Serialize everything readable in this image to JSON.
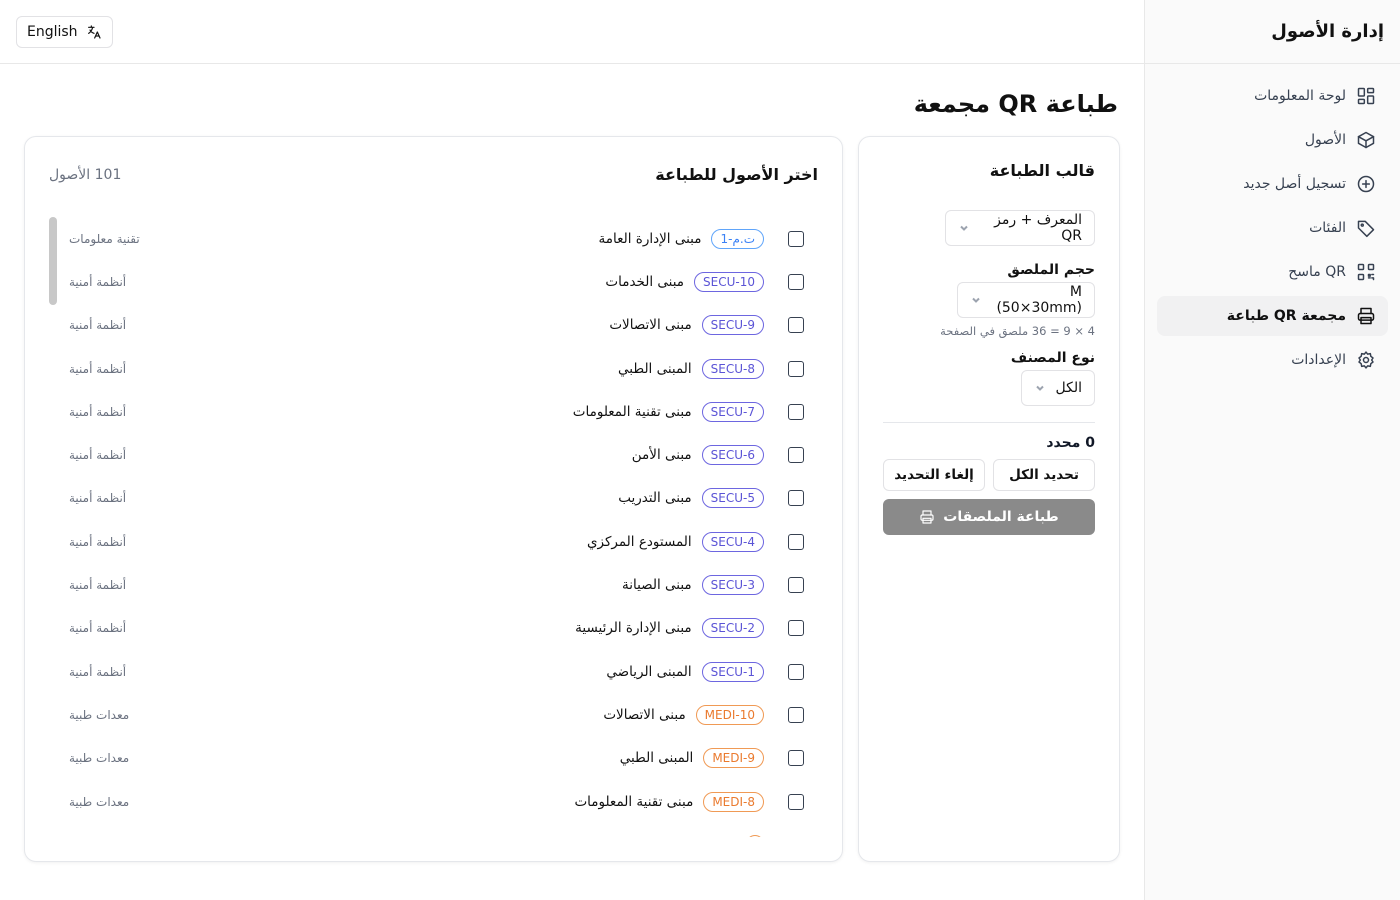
{
  "app": {
    "title": "إدارة الأصول"
  },
  "topbar": {
    "language_label": "English"
  },
  "sidebar": {
    "items": [
      {
        "label": "لوحة المعلومات",
        "icon": "dashboard-icon"
      },
      {
        "label": "الأصول",
        "icon": "box-icon"
      },
      {
        "label": "تسجيل أصل جديد",
        "icon": "plus-circle-icon"
      },
      {
        "label": "الفئات",
        "icon": "tag-icon"
      },
      {
        "label": "ماسح QR",
        "icon": "qr-icon"
      },
      {
        "label": "طباعة QR مجمعة",
        "icon": "printer-icon",
        "active": true
      },
      {
        "label": "الإعدادات",
        "icon": "gear-icon"
      }
    ]
  },
  "page": {
    "title": "طباعة QR مجمعة"
  },
  "template": {
    "title": "قالب الطباعة",
    "template_select": "المعرف + رمز QR",
    "size_label": "حجم الملصق",
    "size_select": "M (50×30mm)",
    "size_hint": "4 × 9 = 36 ملصق في الصفحة",
    "category_label": "نوع المصنف",
    "category_select": "الكل",
    "selected_count": "0 محدد",
    "select_all": "تحديد الكل",
    "deselect": "إلغاء التحديد",
    "print": "طباعة الملصقات"
  },
  "assets": {
    "title": "اختر الأصول للطباعة",
    "count": "101 الأصول",
    "rows": [
      {
        "code": "ت.م-1",
        "name": "مبنى الإدارة العامة",
        "category": "تقنية معلومات",
        "color": "blue"
      },
      {
        "code": "SECU-10",
        "name": "مبنى الخدمات",
        "category": "أنظمة أمنية",
        "color": "indigo"
      },
      {
        "code": "SECU-9",
        "name": "مبنى الاتصالات",
        "category": "أنظمة أمنية",
        "color": "indigo"
      },
      {
        "code": "SECU-8",
        "name": "المبنى الطبي",
        "category": "أنظمة أمنية",
        "color": "indigo"
      },
      {
        "code": "SECU-7",
        "name": "مبنى تقنية المعلومات",
        "category": "أنظمة أمنية",
        "color": "indigo"
      },
      {
        "code": "SECU-6",
        "name": "مبنى الأمن",
        "category": "أنظمة أمنية",
        "color": "indigo"
      },
      {
        "code": "SECU-5",
        "name": "مبنى التدريب",
        "category": "أنظمة أمنية",
        "color": "indigo"
      },
      {
        "code": "SECU-4",
        "name": "المستودع المركزي",
        "category": "أنظمة أمنية",
        "color": "indigo"
      },
      {
        "code": "SECU-3",
        "name": "مبنى الصيانة",
        "category": "أنظمة أمنية",
        "color": "indigo"
      },
      {
        "code": "SECU-2",
        "name": "مبنى الإدارة الرئيسية",
        "category": "أنظمة أمنية",
        "color": "indigo"
      },
      {
        "code": "SECU-1",
        "name": "المبنى الرياضي",
        "category": "أنظمة أمنية",
        "color": "indigo"
      },
      {
        "code": "MEDI-10",
        "name": "مبنى الاتصالات",
        "category": "معدات طبية",
        "color": "orange"
      },
      {
        "code": "MEDI-9",
        "name": "المبنى الطبي",
        "category": "معدات طبية",
        "color": "orange"
      },
      {
        "code": "MEDI-8",
        "name": "مبنى تقنية المعلومات",
        "category": "معدات طبية",
        "color": "orange"
      },
      {
        "code": "",
        "name": "",
        "category": "",
        "color": "orange"
      }
    ]
  },
  "colors": {
    "accent_print": "#8a8a8a",
    "badge_blue": "#3b82f6",
    "badge_indigo": "#5b54d6",
    "badge_orange": "#ea7a2e"
  }
}
